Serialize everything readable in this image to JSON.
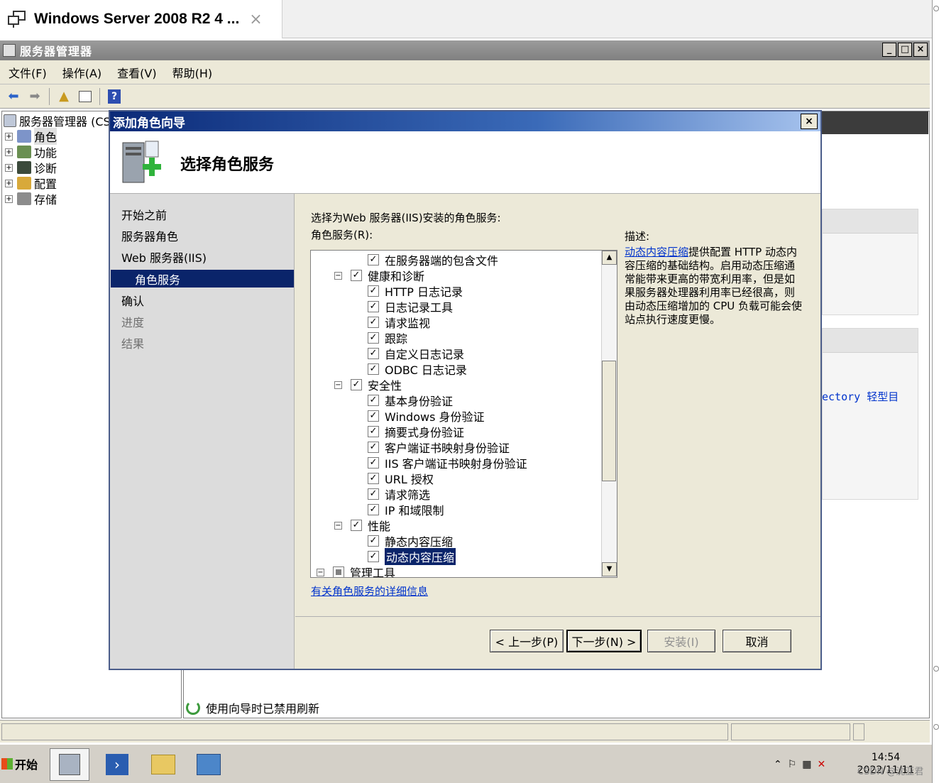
{
  "tab": {
    "title": "Windows Server 2008 R2 4 ...",
    "close": "×"
  },
  "window": {
    "title": "服务器管理器",
    "min": "_",
    "max": "□",
    "close": "×"
  },
  "menu": [
    "文件(F)",
    "操作(A)",
    "查看(V)",
    "帮助(H)"
  ],
  "tree": {
    "root": "服务器管理器 (CS",
    "items": [
      "角色",
      "功能",
      "诊断",
      "配置",
      "存储"
    ]
  },
  "background": {
    "ad_link": "ectory 轻型目",
    "refresh_note": "使用向导时已禁用刷新"
  },
  "wizard": {
    "title": "添加角色向导",
    "close": "×",
    "header": "选择角色服务",
    "nav": [
      "开始之前",
      "服务器角色",
      "Web 服务器(IIS)",
      "角色服务",
      "确认",
      "进度",
      "结果"
    ],
    "prompt": "选择为Web 服务器(IIS)安装的角色服务:",
    "roles_label": "角色服务(R):",
    "items": [
      {
        "label": "在服务器端的包含文件",
        "level": 2,
        "checked": true
      },
      {
        "label": "健康和诊断",
        "level": 1,
        "checked": true,
        "expander": "−"
      },
      {
        "label": "HTTP 日志记录",
        "level": 2,
        "checked": true
      },
      {
        "label": "日志记录工具",
        "level": 2,
        "checked": true
      },
      {
        "label": "请求监视",
        "level": 2,
        "checked": true
      },
      {
        "label": "跟踪",
        "level": 2,
        "checked": true
      },
      {
        "label": "自定义日志记录",
        "level": 2,
        "checked": true
      },
      {
        "label": "ODBC 日志记录",
        "level": 2,
        "checked": true
      },
      {
        "label": "安全性",
        "level": 1,
        "checked": true,
        "expander": "−"
      },
      {
        "label": "基本身份验证",
        "level": 2,
        "checked": true
      },
      {
        "label": "Windows 身份验证",
        "level": 2,
        "checked": true
      },
      {
        "label": "摘要式身份验证",
        "level": 2,
        "checked": true
      },
      {
        "label": "客户端证书映射身份验证",
        "level": 2,
        "checked": true
      },
      {
        "label": "IIS 客户端证书映射身份验证",
        "level": 2,
        "checked": true
      },
      {
        "label": "URL 授权",
        "level": 2,
        "checked": true
      },
      {
        "label": "请求筛选",
        "level": 2,
        "checked": true
      },
      {
        "label": "IP 和域限制",
        "level": 2,
        "checked": true
      },
      {
        "label": "性能",
        "level": 1,
        "checked": true,
        "expander": "−"
      },
      {
        "label": "静态内容压缩",
        "level": 2,
        "checked": true
      },
      {
        "label": "动态内容压缩",
        "level": 2,
        "checked": true,
        "selected": true
      },
      {
        "label": "管理工具",
        "level": 0,
        "checked": "partial",
        "expander": "−"
      }
    ],
    "more_info": "有关角色服务的详细信息",
    "desc_label": "描述:",
    "desc_link": "动态内容压缩",
    "desc_text": "提供配置 HTTP 动态内容压缩的基础结构。启用动态压缩通常能带来更高的带宽利用率，但是如果服务器处理器利用率已经很高，则由动态压缩增加的 CPU 负载可能会使站点执行速度更慢。",
    "buttons": {
      "prev": "< 上一步(P)",
      "next": "下一步(N) >",
      "install": "安装(I)",
      "cancel": "取消"
    }
  },
  "taskbar": {
    "start": "开始",
    "time": "14:54",
    "date": "2022/11/11",
    "watermark": "CSDN @沈亚君"
  },
  "colors": {
    "selection": "#0a246a",
    "title_blue": "#0b2a78",
    "link": "#0033cc"
  }
}
